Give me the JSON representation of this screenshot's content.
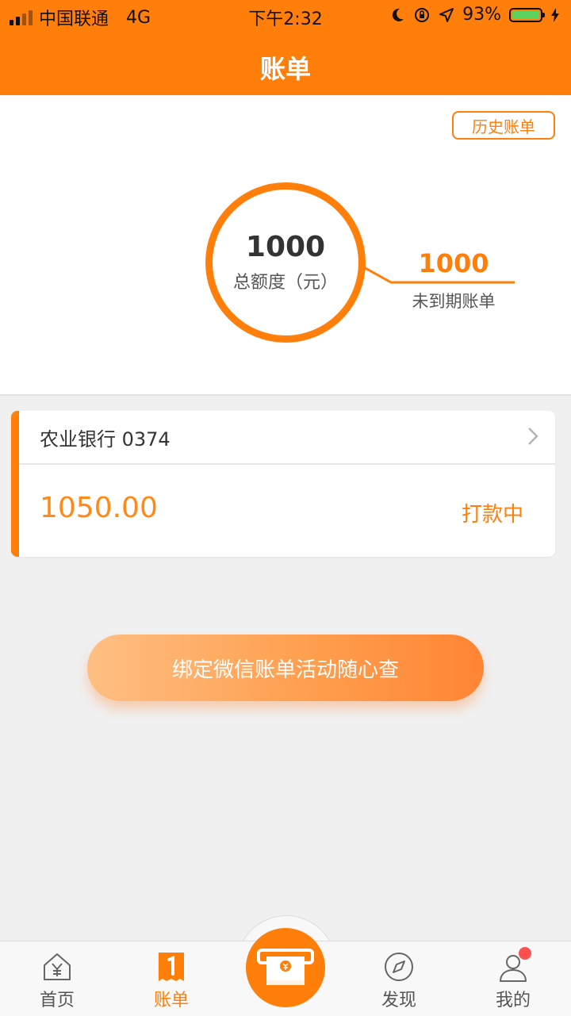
{
  "status_bar": {
    "carrier": "中国联通",
    "network": "4G",
    "time": "下午2:32",
    "battery": "93%"
  },
  "header": {
    "title": "账单"
  },
  "summary": {
    "history_label": "历史账单",
    "total_value": "1000",
    "total_label": "总额度（元）",
    "pending_value": "1000",
    "pending_label": "未到期账单"
  },
  "card": {
    "bank": "农业银行 0374",
    "amount": "1050.00",
    "status": "打款中"
  },
  "cta": {
    "label": "绑定微信账单活动随心查"
  },
  "tabbar": {
    "items": [
      {
        "label": "首页",
        "icon": "home-yen-icon"
      },
      {
        "label": "账单",
        "icon": "bill-icon"
      },
      {
        "label": "",
        "icon": "cash-machine-icon"
      },
      {
        "label": "发现",
        "icon": "compass-icon"
      },
      {
        "label": "我的",
        "icon": "user-icon"
      }
    ],
    "active": "账单"
  },
  "colors": {
    "accent": "#ff7f0a",
    "background": "#f0f0f0"
  }
}
